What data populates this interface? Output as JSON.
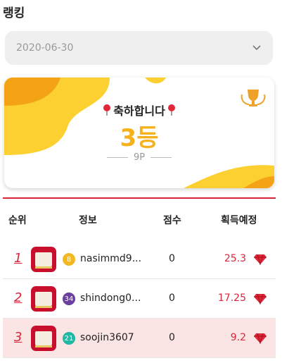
{
  "header": {
    "title": "랭킹"
  },
  "date_select": {
    "value": "2020-06-30",
    "icon": "chevron-down-icon"
  },
  "result_card": {
    "congrats": "축하합니다",
    "rank": "3등",
    "points": "9P",
    "icons": [
      "pin-icon",
      "trophy-icon"
    ]
  },
  "table": {
    "headers": {
      "rank": "순위",
      "info": "정보",
      "score": "점수",
      "expected": "획득예정"
    },
    "rows": [
      {
        "rank": "1",
        "level": "8",
        "level_color": "#f2b822",
        "name": "nasimmd9...",
        "score": "0",
        "expected": "25.3",
        "highlight": false
      },
      {
        "rank": "2",
        "level": "34",
        "level_color": "#6a3fa0",
        "name": "shindong0...",
        "score": "0",
        "expected": "17.25",
        "highlight": false
      },
      {
        "rank": "3",
        "level": "21",
        "level_color": "#1fb8a5",
        "name": "soojin3607",
        "score": "0",
        "expected": "9.2",
        "highlight": true
      }
    ]
  },
  "colors": {
    "accent": "#d9263b",
    "gold": "#f5b21c",
    "highlight_row": "#fbe4e4"
  }
}
